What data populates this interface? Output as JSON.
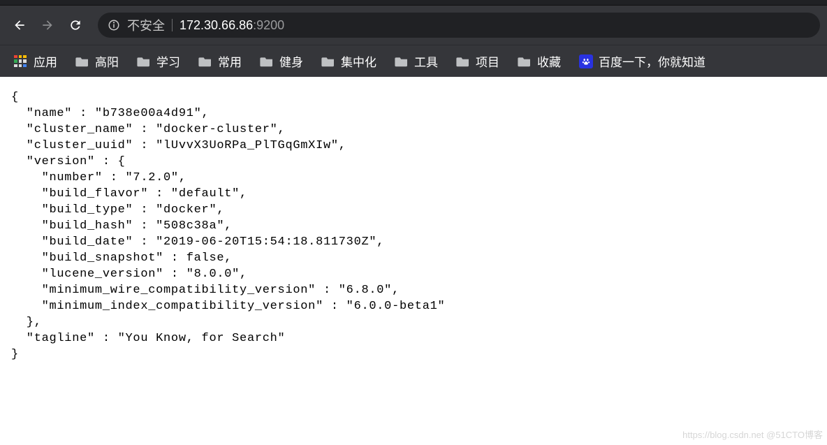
{
  "toolbar": {
    "security_label": "不安全",
    "url_host": "172.30.66.86",
    "url_port": ":9200"
  },
  "bookmarks": {
    "apps_label": "应用",
    "items": [
      {
        "label": "高阳"
      },
      {
        "label": "学习"
      },
      {
        "label": "常用"
      },
      {
        "label": "健身"
      },
      {
        "label": "集中化"
      },
      {
        "label": "工具"
      },
      {
        "label": "项目"
      },
      {
        "label": "收藏"
      }
    ],
    "baidu_label": "百度一下，你就知道"
  },
  "json_body": "{\n  \"name\" : \"b738e00a4d91\",\n  \"cluster_name\" : \"docker-cluster\",\n  \"cluster_uuid\" : \"lUvvX3UoRPa_PlTGqGmXIw\",\n  \"version\" : {\n    \"number\" : \"7.2.0\",\n    \"build_flavor\" : \"default\",\n    \"build_type\" : \"docker\",\n    \"build_hash\" : \"508c38a\",\n    \"build_date\" : \"2019-06-20T15:54:18.811730Z\",\n    \"build_snapshot\" : false,\n    \"lucene_version\" : \"8.0.0\",\n    \"minimum_wire_compatibility_version\" : \"6.8.0\",\n    \"minimum_index_compatibility_version\" : \"6.0.0-beta1\"\n  },\n  \"tagline\" : \"You Know, for Search\"\n}",
  "watermark": "https://blog.csdn.net @51CTO博客"
}
